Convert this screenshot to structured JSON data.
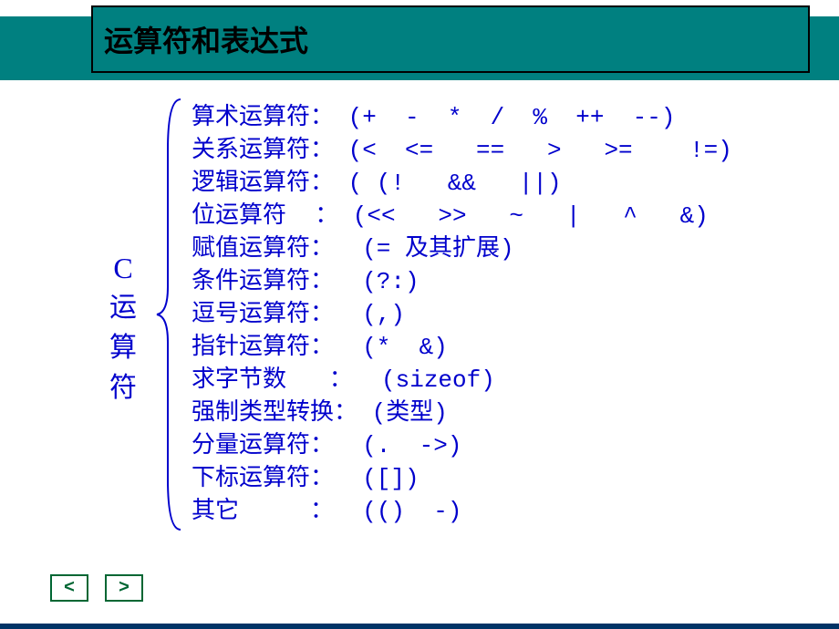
{
  "title": "运算符和表达式",
  "label": {
    "c": "C",
    "line1": "运",
    "line2": "算",
    "line3": "符"
  },
  "rows": [
    "算术运算符： (+  -  *  /  %  ++  --)",
    "关系运算符： (<  <=   ==   >   >=    !=)",
    "逻辑运算符： ( (!   &&   ||)",
    "位运算符  ： (<<   >>   ~   |   ^   &)",
    "赋值运算符：  (= 及其扩展)",
    "条件运算符：  (?:)",
    "逗号运算符：  (,)",
    "指针运算符：  (*  &)",
    "求字节数   ：  (sizeof)",
    "强制类型转换： (类型)",
    "分量运算符：  (.  ->)",
    "下标运算符：  ([])",
    "其它     ：  (()  -)"
  ],
  "nav": {
    "prev": "<",
    "next": ">"
  },
  "colors": {
    "teal": "#008080",
    "text_blue": "#0000cc",
    "nav_green": "#006633"
  }
}
